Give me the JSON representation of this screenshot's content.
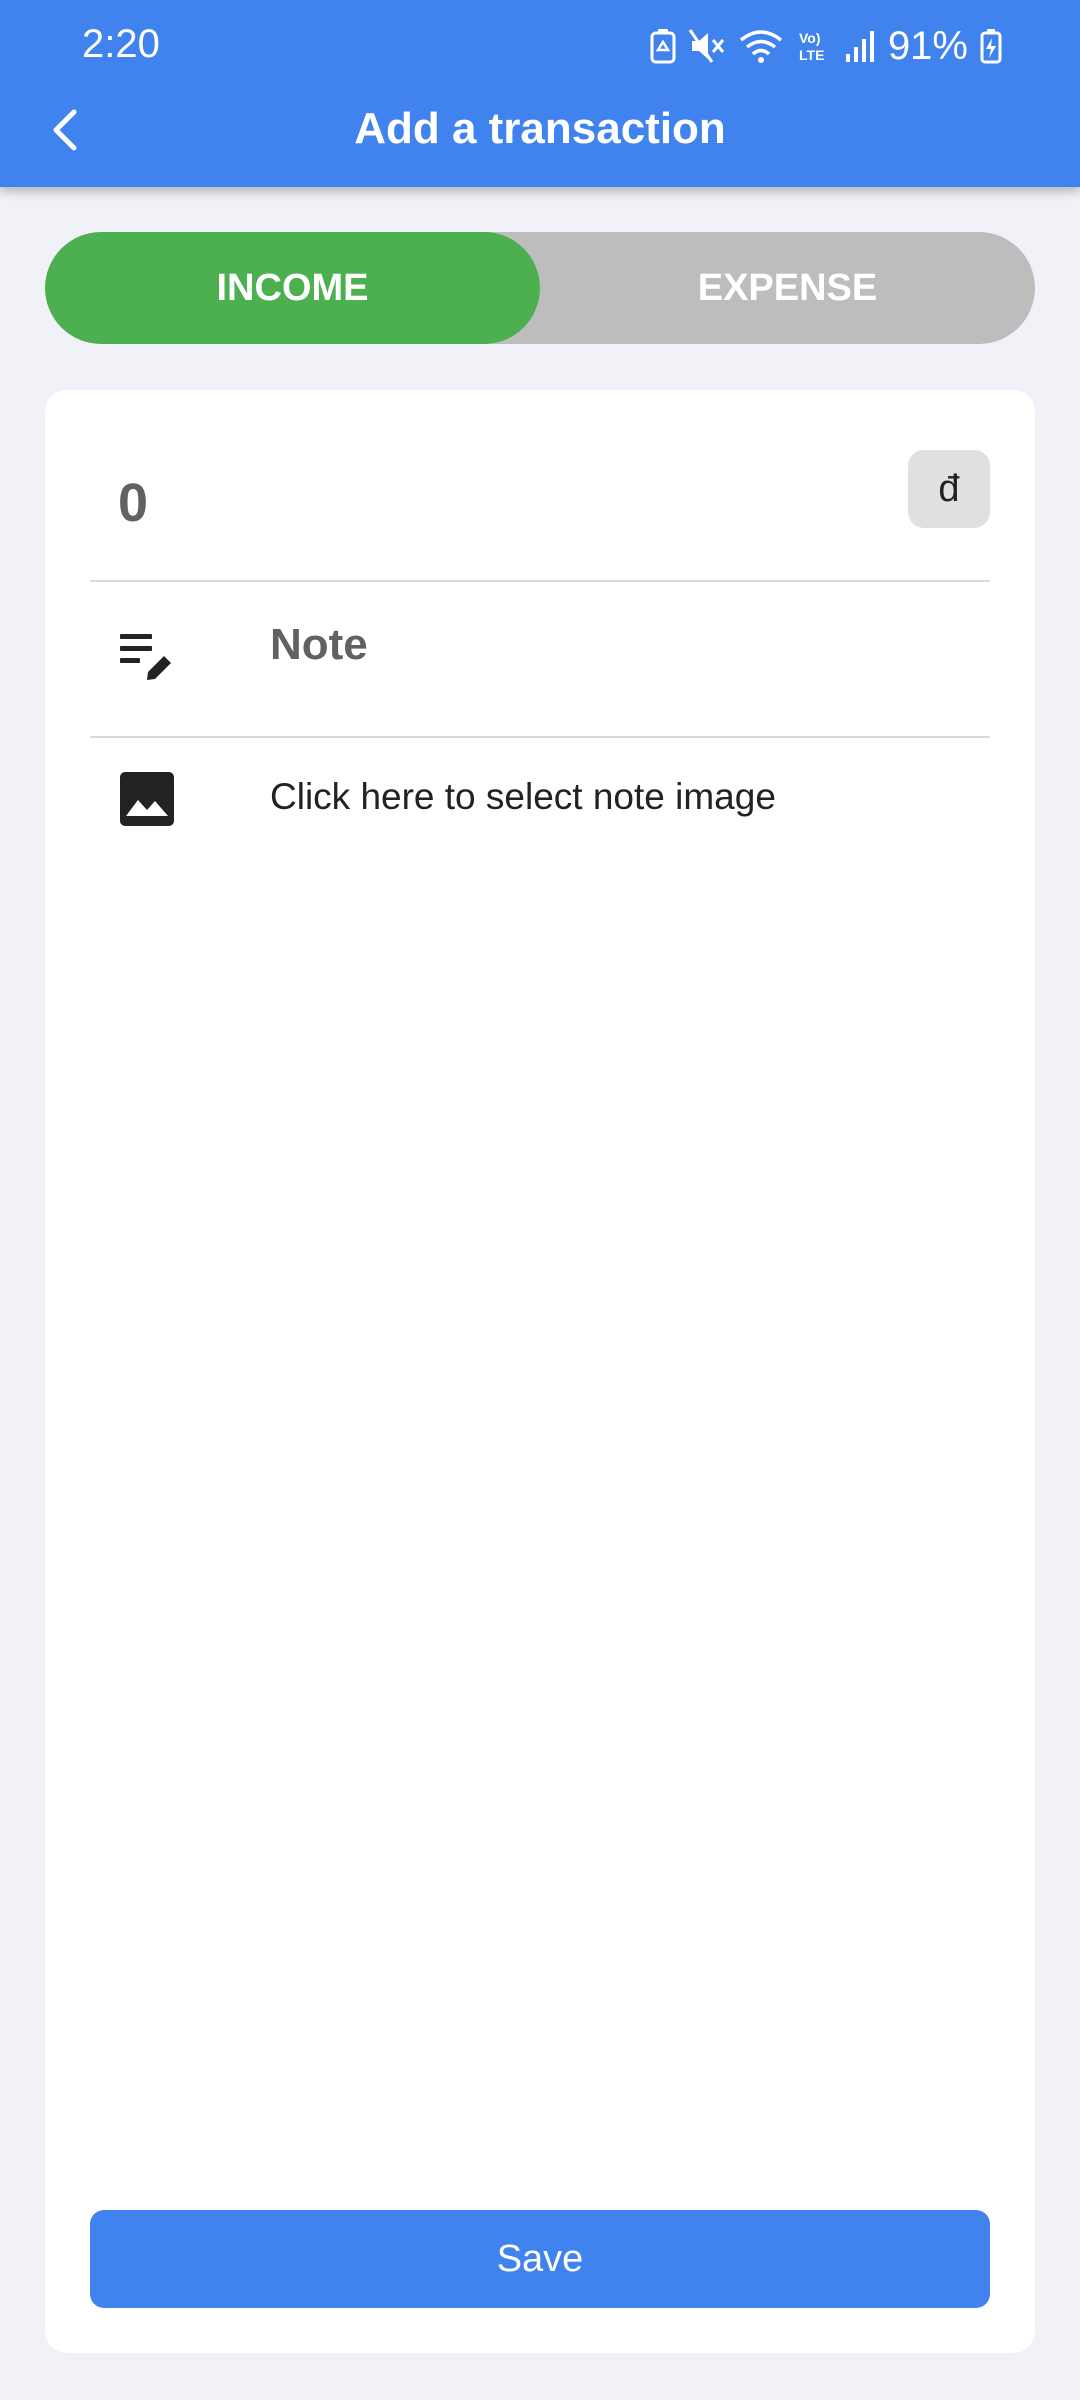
{
  "status_bar": {
    "time": "2:20",
    "battery_percent": "91%"
  },
  "header": {
    "title": "Add a transaction"
  },
  "type_toggle": {
    "income_label": "INCOME",
    "expense_label": "EXPENSE",
    "selected": "INCOME"
  },
  "form": {
    "amount_value": "0",
    "currency_symbol": "đ",
    "note_placeholder": "Note",
    "image_prompt": "Click here to select note image"
  },
  "actions": {
    "save_label": "Save"
  },
  "colors": {
    "primary": "#4183ee",
    "income_active": "#4caf50",
    "toggle_inactive": "#bdbdbd",
    "background": "#f0f2f7"
  },
  "icons": [
    "back-arrow-icon",
    "note-edit-icon",
    "image-icon",
    "battery-saver-icon",
    "mute-icon",
    "wifi-icon",
    "volte-icon",
    "signal-icon",
    "battery-charging-icon"
  ]
}
